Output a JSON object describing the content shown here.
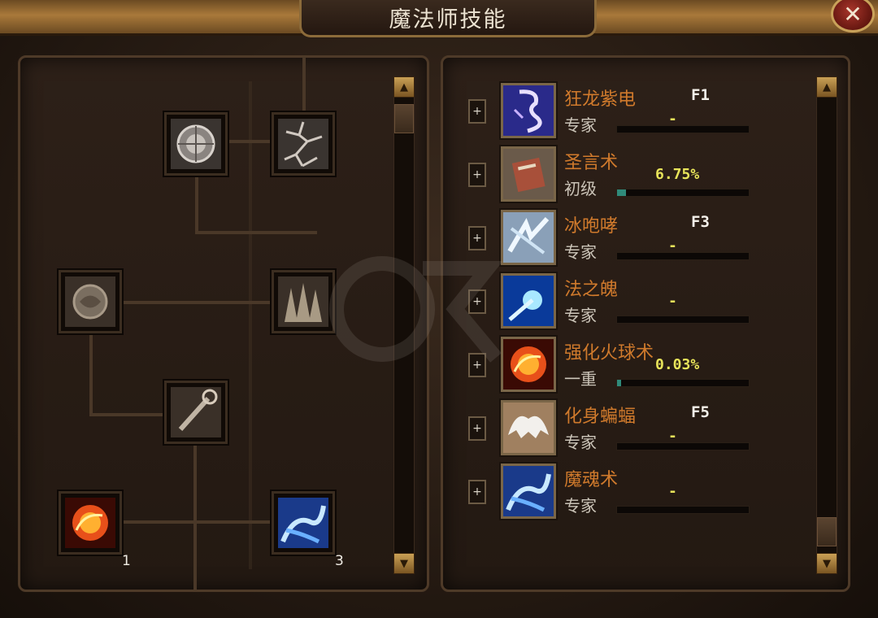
{
  "window": {
    "title": "魔法师技能",
    "close_label": "✕"
  },
  "skill_tree": {
    "scroll_up": "▲",
    "scroll_down": "▼",
    "nodes": [
      {
        "icon": "shield-orb-icon"
      },
      {
        "icon": "lightning-web-icon"
      },
      {
        "icon": "stone-orb-icon"
      },
      {
        "icon": "ice-spikes-icon"
      },
      {
        "icon": "staff-wand-icon"
      },
      {
        "icon": "fireball-icon",
        "count": "1"
      },
      {
        "icon": "ice-dragon-icon",
        "count": "3"
      }
    ]
  },
  "skill_list": {
    "scroll_up": "▲",
    "scroll_down": "▼",
    "skills": [
      {
        "name": "狂龙紫电",
        "level": "专家",
        "key": "F1",
        "progress": "-",
        "exp_fraction": 0,
        "icon": "purple-lightning-icon"
      },
      {
        "name": "圣言术",
        "level": "初级",
        "key": "",
        "progress": "6.75%",
        "exp_fraction": 0.0675,
        "icon": "holy-book-icon"
      },
      {
        "name": "冰咆哮",
        "level": "专家",
        "key": "F3",
        "progress": "-",
        "exp_fraction": 0,
        "icon": "ice-roar-icon"
      },
      {
        "name": "法之魄",
        "level": "专家",
        "key": "",
        "progress": "-",
        "exp_fraction": 0,
        "icon": "magic-soul-icon"
      },
      {
        "name": "强化火球术",
        "level": "一重",
        "key": "",
        "progress": "0.03%",
        "exp_fraction": 0.0003,
        "icon": "fireball-icon"
      },
      {
        "name": "化身蝙蝠",
        "level": "专家",
        "key": "F5",
        "progress": "-",
        "exp_fraction": 0,
        "icon": "bat-wings-icon"
      },
      {
        "name": "魔魂术",
        "level": "专家",
        "key": "",
        "progress": "-",
        "exp_fraction": 0,
        "icon": "ice-dragon-icon"
      }
    ]
  },
  "colors": {
    "skill_name": "#d07a2c",
    "progress_text": "#e8e45a",
    "frame_gold": "#a9793a"
  }
}
